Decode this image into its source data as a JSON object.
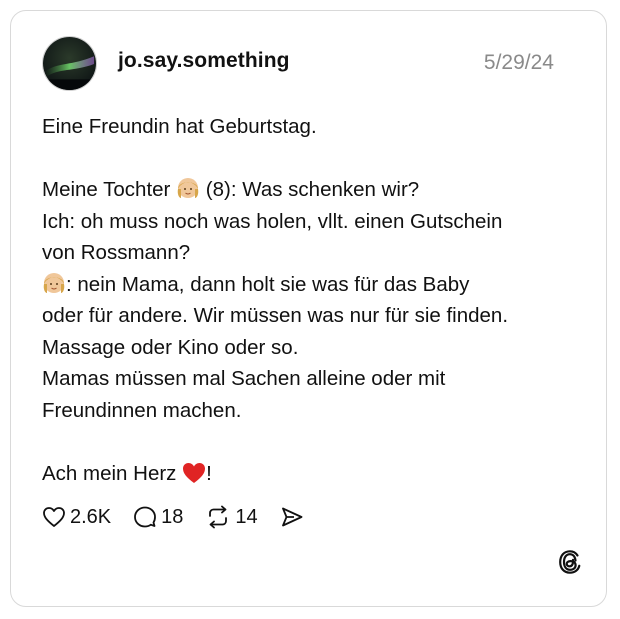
{
  "post": {
    "username": "jo.say.something",
    "date": "5/29/24",
    "lines": [
      {
        "text": "Eine Freundin hat Geburtstag."
      },
      {
        "text": ""
      },
      {
        "before": "Meine Tochter ",
        "emoji": "girl-emoji",
        "after": " (8): Was schenken wir?"
      },
      {
        "text": "Ich: oh muss noch was holen, vllt. einen Gutschein"
      },
      {
        "text": "von Rossmann?"
      },
      {
        "before": "",
        "emoji": "girl-emoji",
        "after": ": nein Mama, dann holt sie was für das Baby"
      },
      {
        "text": "oder für andere. Wir müssen was nur für sie finden."
      },
      {
        "text": "Massage oder Kino oder so."
      },
      {
        "text": "Mamas müssen mal Sachen alleine oder mit"
      },
      {
        "text": "Freundinnen machen."
      },
      {
        "text": ""
      },
      {
        "before": "Ach mein Herz ",
        "emoji": "red-heart-emoji",
        "after": "!"
      }
    ]
  },
  "actions": {
    "likes": "2.6K",
    "replies": "18",
    "reposts": "14"
  },
  "icons": {
    "like": "heart-outline-icon",
    "reply": "comment-bubble-icon",
    "repost": "repost-arrows-icon",
    "share": "send-icon",
    "brand": "threads-logo-icon"
  },
  "colors": {
    "username": "#111111",
    "date": "#8a8a8a",
    "heart_emoji": "#e02424",
    "border": "#d9d9d9"
  }
}
